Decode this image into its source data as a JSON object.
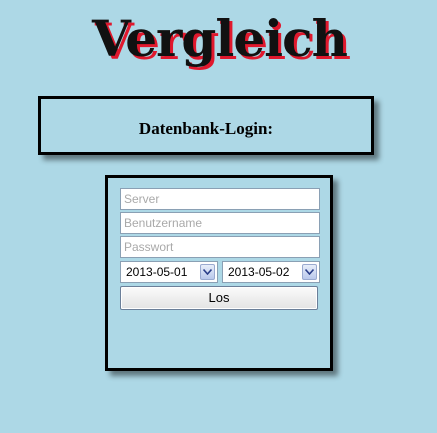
{
  "page": {
    "title": "Vergleich",
    "title_color": "#111111",
    "title_shadow_color": "#e0182d",
    "background": "#add8e6"
  },
  "login": {
    "heading": "Datenbank-Login:"
  },
  "form": {
    "server_placeholder": "Server",
    "username_placeholder": "Benutzername",
    "password_placeholder": "Passwort",
    "date_from": "2013-05-01",
    "date_to": "2013-05-02",
    "submit_label": "Los"
  },
  "icons": {
    "dropdown": "chevron-down-icon"
  }
}
